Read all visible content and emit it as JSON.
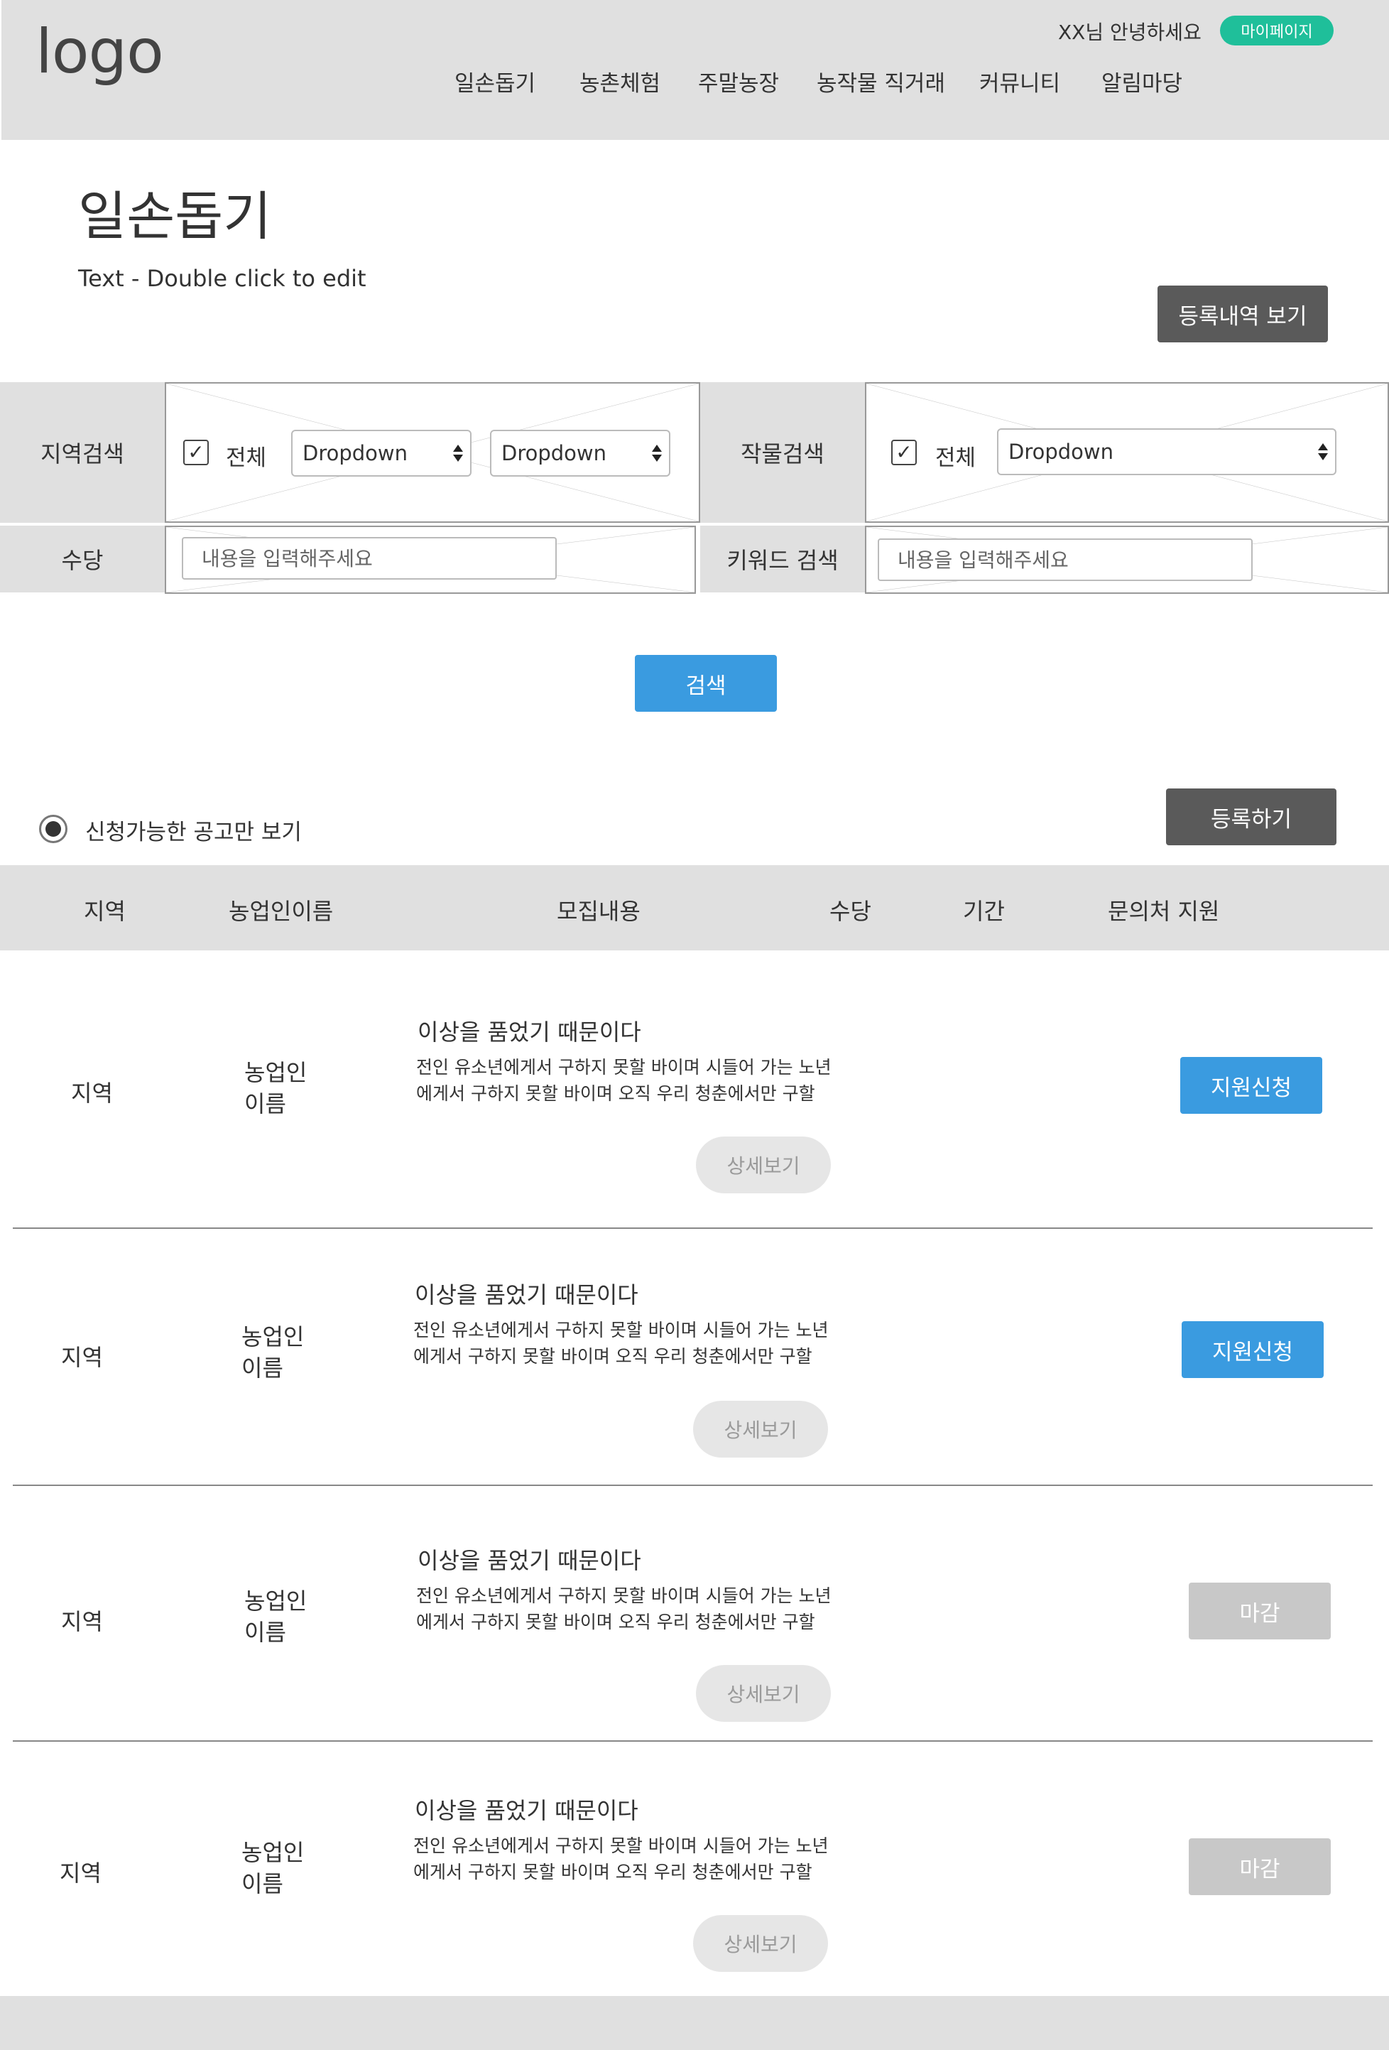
{
  "header": {
    "logo": "logo",
    "greeting": "XX님 안녕하세요",
    "mypage_label": "마이페이지",
    "nav": [
      "일손돕기",
      "농촌체험",
      "주말농장",
      "농작물 직거래",
      "커뮤니티",
      "알림마당"
    ]
  },
  "page": {
    "title": "일손돕기",
    "subtitle": "Text - Double click to edit",
    "history_button": "등록내역 보기"
  },
  "search": {
    "region_label": "지역검색",
    "region_all": "전체",
    "region_dropdown_1": "Dropdown",
    "region_dropdown_2": "Dropdown",
    "crop_label": "작물검색",
    "crop_all": "전체",
    "crop_dropdown": "Dropdown",
    "allowance_label": "수당",
    "allowance_placeholder": "내용을 입력해주세요",
    "keyword_label": "키워드 검색",
    "keyword_placeholder": "내용을 입력해주세요",
    "search_button": "검색",
    "checkmark": "✓"
  },
  "filter": {
    "available_only_label": "신청가능한 공고만 보기",
    "register_button": "등록하기"
  },
  "table": {
    "headers": [
      "지역",
      "농업인이름",
      "모집내용",
      "수당",
      "기간",
      "문의처 지원"
    ],
    "rows": [
      {
        "region": "지역",
        "farmer_line1": "농업인",
        "farmer_line2": "이름",
        "title": "이상을 품었기 때문이다",
        "desc_line1": "전인 유소년에게서 구하지 못할 바이며 시들어 가는 노년",
        "desc_line2": "에게서 구하지 못할 바이며 오직 우리 청춘에서만 구할",
        "detail_button": "상세보기",
        "action_label": "지원신청",
        "status": "open"
      },
      {
        "region": "지역",
        "farmer_line1": "농업인",
        "farmer_line2": "이름",
        "title": "이상을 품었기 때문이다",
        "desc_line1": "전인 유소년에게서 구하지 못할 바이며 시들어 가는 노년",
        "desc_line2": "에게서 구하지 못할 바이며 오직 우리 청춘에서만 구할",
        "detail_button": "상세보기",
        "action_label": "지원신청",
        "status": "open"
      },
      {
        "region": "지역",
        "farmer_line1": "농업인",
        "farmer_line2": "이름",
        "title": "이상을 품었기 때문이다",
        "desc_line1": "전인 유소년에게서 구하지 못할 바이며 시들어 가는 노년",
        "desc_line2": "에게서 구하지 못할 바이며 오직 우리 청춘에서만 구할",
        "detail_button": "상세보기",
        "action_label": "마감",
        "status": "closed"
      },
      {
        "region": "지역",
        "farmer_line1": "농업인",
        "farmer_line2": "이름",
        "title": "이상을 품었기 때문이다",
        "desc_line1": "전인 유소년에게서 구하지 못할 바이며 시들어 가는 노년",
        "desc_line2": "에게서 구하지 못할 바이며 오직 우리 청춘에서만 구할",
        "detail_button": "상세보기",
        "action_label": "마감",
        "status": "closed"
      }
    ]
  },
  "colors": {
    "header_bg": "#e0e0e0",
    "accent_blue": "#3a9be0",
    "mypage_green": "#1fbf9a",
    "dark_button": "#5a5a5a",
    "closed_button": "#c8c8c8"
  }
}
